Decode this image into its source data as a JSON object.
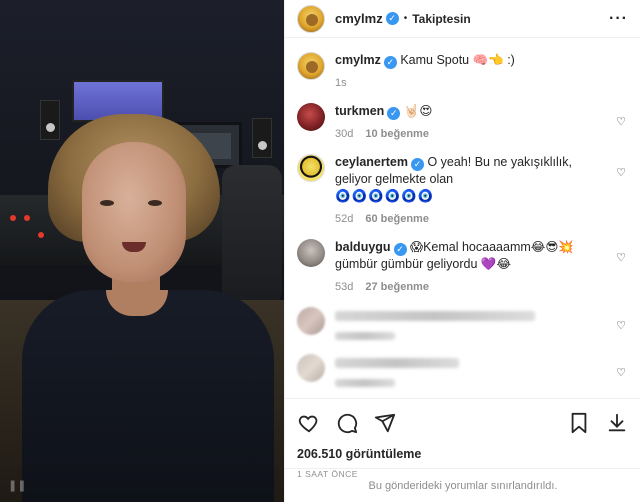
{
  "post": {
    "username": "cmylmz",
    "follow_status": "Takiptesin",
    "caption_user": "cmylmz",
    "caption_text": "Kamu Spotu 🧠👈 :)",
    "caption_time": "1s",
    "views": "206.510 görüntüleme",
    "posted_ago": "1 SAAT ÖNCE",
    "comments_restricted": "Bu gönderideki yorumlar sınırlandırıldı."
  },
  "comments": [
    {
      "user": "turkmen",
      "text": "🤘🏻😍",
      "time": "30d",
      "likes": "10 beğenme"
    },
    {
      "user": "ceylanertem",
      "text": "O yeah! Bu ne yakışıklılık, geliyor gelmekte olan",
      "text2": "🧿🧿🧿🧿🧿🧿",
      "time": "52d",
      "likes": "60 beğenme"
    },
    {
      "user": "balduygu",
      "text": "😱Kemal hocaaaamm😂😎💥 gümbür gümbür geliyordu 💜😂",
      "time": "53d",
      "likes": "27 beğenme"
    }
  ],
  "icons": {
    "verified": "verified-badge-icon",
    "heart": "heart-icon",
    "comment": "comment-icon",
    "share": "share-icon",
    "save": "bookmark-icon",
    "download": "download-icon",
    "more": "more-icon"
  },
  "colors": {
    "verified_blue": "#3897f0",
    "meta_gray": "#8e8e8e",
    "text": "#262626"
  }
}
